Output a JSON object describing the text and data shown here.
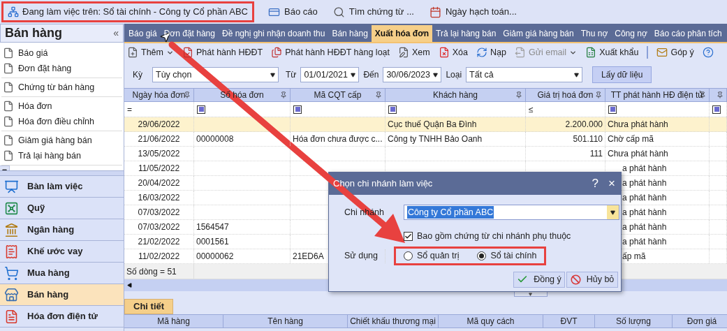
{
  "top_bar": {
    "context": {
      "text": "Đang làm việc trên: Sổ tài chính - Công ty Cổ phần ABC",
      "highlighted": true
    },
    "items": [
      {
        "label": "Báo cáo",
        "kind": "report"
      },
      {
        "label": "Tìm chứng từ ...",
        "kind": "search"
      },
      {
        "label": "Ngày hạch toán...",
        "kind": "calendar"
      }
    ]
  },
  "sidebar": {
    "title": "Bán hàng",
    "collapse": "«",
    "groups": [
      [
        "Báo giá",
        "Đơn đặt hàng"
      ],
      [
        "Chứng từ bán hàng"
      ],
      [
        "Hóa đơn",
        "Hóa đơn điều chỉnh"
      ],
      [
        "Giảm giá hàng bán",
        "Trả lại hàng bán"
      ]
    ],
    "modules": [
      {
        "label": "Bàn làm việc",
        "kind": "desk",
        "selected": false
      },
      {
        "label": "Quỹ",
        "kind": "fund",
        "selected": false
      },
      {
        "label": "Ngân hàng",
        "kind": "bank",
        "selected": false
      },
      {
        "label": "Khế ước vay",
        "kind": "loan",
        "selected": false
      },
      {
        "label": "Mua hàng",
        "kind": "purchase",
        "selected": false
      },
      {
        "label": "Bán hàng",
        "kind": "sales",
        "selected": true
      },
      {
        "label": "Hóa đơn điện tử",
        "kind": "einvoice",
        "selected": false
      }
    ]
  },
  "tabs": [
    {
      "label": "Báo giá",
      "selected": false
    },
    {
      "label": "Đơn đặt hàng",
      "selected": false
    },
    {
      "label": "Đề nghị ghi nhận doanh thu",
      "selected": false
    },
    {
      "label": "Bán hàng",
      "selected": false
    },
    {
      "label": "Xuất hóa đơn",
      "selected": true
    },
    {
      "label": "Trả lại hàng bán",
      "selected": false
    },
    {
      "label": "Giảm giá hàng bán",
      "selected": false
    },
    {
      "label": "Thu nợ",
      "selected": false
    },
    {
      "label": "Công nợ",
      "selected": false
    },
    {
      "label": "Báo cáo phân tích",
      "selected": false
    }
  ],
  "toolbar": [
    {
      "label": "Thêm",
      "kind": "add",
      "dropdown": true,
      "disabled": false
    },
    {
      "label": "Phát hành HĐĐT",
      "kind": "issue",
      "dropdown": false,
      "disabled": false
    },
    {
      "label": "Phát hành HĐĐT hàng loạt",
      "kind": "issue_batch",
      "dropdown": false,
      "disabled": false
    },
    {
      "label": "Xem",
      "kind": "view",
      "dropdown": false,
      "disabled": false
    },
    {
      "label": "Xóa",
      "kind": "delete",
      "dropdown": false,
      "disabled": false
    },
    {
      "label": "Nạp",
      "kind": "reload",
      "dropdown": false,
      "disabled": false
    },
    {
      "label": "Gửi email",
      "kind": "email",
      "dropdown": true,
      "disabled": true
    },
    {
      "label": "Xuất khẩu",
      "kind": "export",
      "dropdown": false,
      "disabled": false
    },
    {
      "label": "Góp ý",
      "kind": "feedback",
      "dropdown": false,
      "disabled": false,
      "separator_before": true
    },
    {
      "kind": "help",
      "dropdown": false,
      "disabled": false
    }
  ],
  "filter": {
    "period_label": "Kỳ",
    "period": "Tùy chọn",
    "from_label": "Từ",
    "from": "01/01/2021",
    "to_label": "Đến",
    "to": "30/06/2023",
    "type_label": "Loại",
    "type": "Tất cả",
    "button": "Lấy dữ liệu"
  },
  "grid": {
    "columns": [
      {
        "title": "Ngày hóa đơn",
        "filter": {
          "kind": "operator",
          "text": "="
        }
      },
      {
        "title": "Số hóa đơn",
        "filter": {
          "kind": "checkbox"
        }
      },
      {
        "title": "Mã CQT cấp",
        "filter": {
          "kind": "checkbox"
        }
      },
      {
        "title": "Khách hàng",
        "filter": {
          "kind": "checkbox"
        }
      },
      {
        "title": "Giá trị hoá đơn",
        "filter": {
          "kind": "operator",
          "text": "≤"
        }
      },
      {
        "title": "TT phát hành HĐ điện tử",
        "filter": {
          "kind": "checkbox"
        }
      },
      {
        "filter": {
          "kind": "checkbox"
        }
      }
    ],
    "rows": [
      {
        "selected": true,
        "under_dialog": false,
        "cells": [
          "29/06/2022",
          null,
          null,
          "Cục thuế Quận Ba Đình",
          "2.200.000",
          "Chưa phát hành",
          null
        ]
      },
      {
        "selected": false,
        "under_dialog": false,
        "cells": [
          "21/06/2022",
          "00000008",
          "Hóa đơn chưa được c...",
          "Công ty TNHH Bảo Oanh",
          "501.110",
          "Chờ cấp mã",
          null
        ]
      },
      {
        "selected": false,
        "under_dialog": false,
        "cells": [
          "13/05/2022",
          null,
          null,
          null,
          "111",
          "Chưa phát hành",
          null
        ]
      },
      {
        "selected": false,
        "under_dialog": true,
        "cells": [
          "11/05/2022",
          null,
          null,
          null,
          null,
          "a phát hành",
          null
        ]
      },
      {
        "selected": false,
        "under_dialog": true,
        "cells": [
          "20/04/2022",
          null,
          null,
          null,
          null,
          "a phát hành",
          null
        ]
      },
      {
        "selected": false,
        "under_dialog": true,
        "cells": [
          "16/03/2022",
          null,
          null,
          null,
          null,
          "a phát hành",
          null
        ]
      },
      {
        "selected": false,
        "under_dialog": true,
        "cells": [
          "07/03/2022",
          null,
          null,
          null,
          null,
          "a phát hành",
          null
        ]
      },
      {
        "selected": false,
        "under_dialog": true,
        "cells": [
          "07/03/2022",
          "1564547",
          null,
          null,
          null,
          "a phát hành",
          null
        ]
      },
      {
        "selected": false,
        "under_dialog": true,
        "cells": [
          "21/02/2022",
          "0001561",
          null,
          null,
          null,
          "a phát hành",
          null
        ]
      },
      {
        "selected": false,
        "under_dialog": true,
        "cells": [
          "11/02/2022",
          "00000062",
          "21ED6A",
          null,
          null,
          "ấp mã",
          null
        ]
      }
    ],
    "footer": "Số dòng = 51"
  },
  "detail": {
    "tab": "Chi tiết",
    "columns": [
      "Mã hàng",
      "Tên hàng",
      "Chiết khấu thương mại",
      "Mã quy cách",
      "ĐVT",
      "Số lượng",
      "Đơn giá"
    ]
  },
  "dialog": {
    "title": "Chọn chi nhánh làm việc",
    "help": "?",
    "close": "×",
    "branch_label": "Chi nhánh",
    "branch": "Công ty Cổ phần ABC",
    "include": {
      "label": "Bao gồm chứng từ chi nhánh phụ thuộc",
      "checked": true
    },
    "use_label": "Sử dụng",
    "options_highlighted": true,
    "options": [
      {
        "label": "Sổ quản trị",
        "selected": false
      },
      {
        "label": "Sổ tài chính",
        "selected": true
      }
    ],
    "buttons": [
      {
        "label": "Đồng ý",
        "kind": "ok"
      },
      {
        "label": "Hủy bỏ",
        "kind": "cancel"
      }
    ]
  }
}
